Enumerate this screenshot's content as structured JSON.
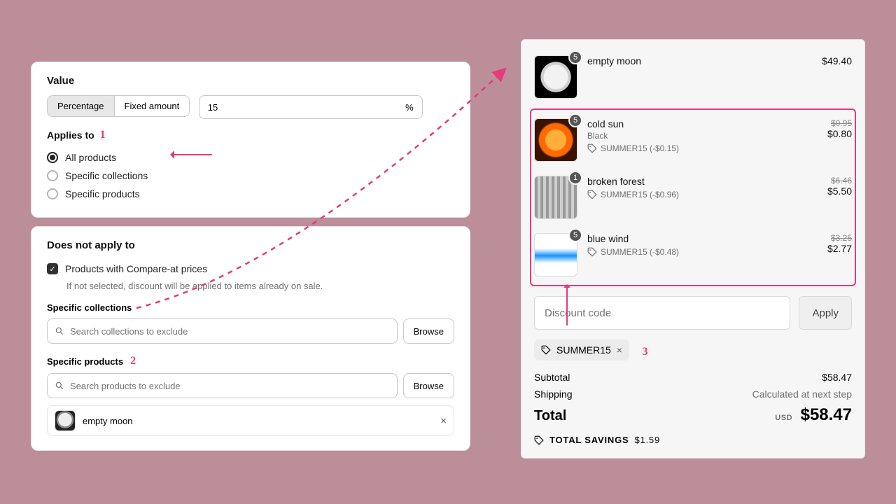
{
  "annotations": {
    "n1": "1",
    "n2": "2",
    "n3": "3"
  },
  "value": {
    "heading": "Value",
    "seg": {
      "percentage": "Percentage",
      "fixed": "Fixed amount"
    },
    "amount": "15",
    "unit": "%",
    "applies_to": "Applies to",
    "radios": {
      "all": "All products",
      "collections": "Specific collections",
      "products": "Specific products"
    }
  },
  "exclude": {
    "heading": "Does not apply to",
    "checkbox_label": "Products with Compare-at prices",
    "checkbox_hint": "If not selected, discount will be applied to items already on sale.",
    "collections_label": "Specific collections",
    "collections_placeholder": "Search collections to exclude",
    "products_label": "Specific products",
    "products_placeholder": "Search products to exclude",
    "browse": "Browse",
    "chip": "empty moon"
  },
  "cart": {
    "items": [
      {
        "name": "empty moon",
        "qty": "5",
        "now": "$49.40"
      },
      {
        "name": "cold sun",
        "variant": "Black",
        "qty": "5",
        "tag": "SUMMER15 (-$0.15)",
        "orig": "$0.95",
        "now": "$0.80"
      },
      {
        "name": "broken forest",
        "qty": "1",
        "tag": "SUMMER15 (-$0.96)",
        "orig": "$6.46",
        "now": "$5.50"
      },
      {
        "name": "blue wind",
        "qty": "5",
        "tag": "SUMMER15 (-$0.48)",
        "orig": "$3.25",
        "now": "$2.77"
      }
    ],
    "code_placeholder": "Discount code",
    "apply": "Apply",
    "applied_code": "SUMMER15",
    "subtotal_label": "Subtotal",
    "subtotal_value": "$58.47",
    "shipping_label": "Shipping",
    "shipping_value": "Calculated at next step",
    "total_label": "Total",
    "currency": "USD",
    "total_value": "$58.47",
    "savings_label": "TOTAL SAVINGS",
    "savings_value": "$1.59"
  }
}
